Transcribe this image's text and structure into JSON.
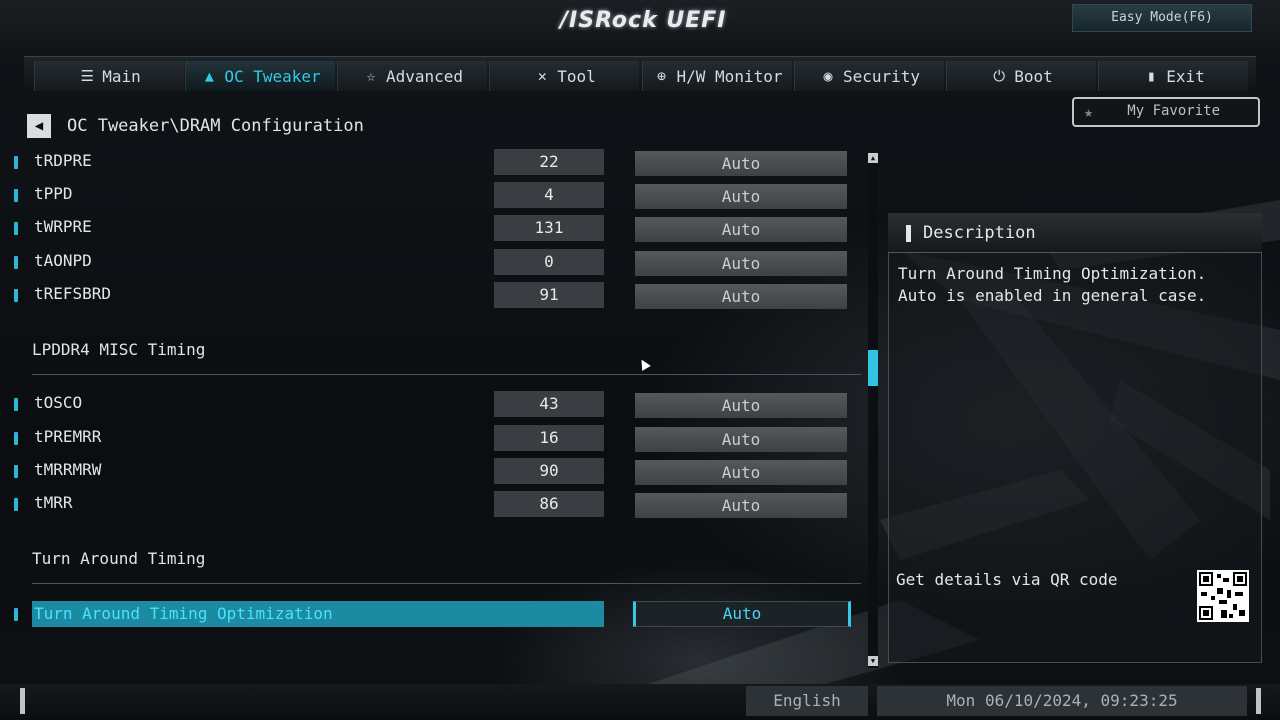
{
  "header": {
    "logo_text": "/ISRock UEFI",
    "easy_mode_label": "Easy Mode(F6)"
  },
  "tabs": [
    {
      "label": "Main",
      "icon": "list-icon"
    },
    {
      "label": "OC Tweaker",
      "icon": "rocket-icon",
      "active": true
    },
    {
      "label": "Advanced",
      "icon": "star-icon"
    },
    {
      "label": "Tool",
      "icon": "tools-icon"
    },
    {
      "label": "H/W Monitor",
      "icon": "crosshair-icon"
    },
    {
      "label": "Security",
      "icon": "shield-icon"
    },
    {
      "label": "Boot",
      "icon": "power-icon"
    },
    {
      "label": "Exit",
      "icon": "exit-door-icon"
    }
  ],
  "breadcrumb": "OC Tweaker\\DRAM Configuration",
  "favorite_label": "My Favorite",
  "rows_top": [
    {
      "name": "tRDPRE",
      "value": "22",
      "mode": "Auto"
    },
    {
      "name": "tPPD",
      "value": "4",
      "mode": "Auto"
    },
    {
      "name": "tWRPRE",
      "value": "131",
      "mode": "Auto"
    },
    {
      "name": "tAONPD",
      "value": "0",
      "mode": "Auto"
    },
    {
      "name": "tREFSBRD",
      "value": "91",
      "mode": "Auto"
    }
  ],
  "section_misc": "LPDDR4 MISC Timing",
  "rows_misc": [
    {
      "name": "tOSCO",
      "value": "43",
      "mode": "Auto"
    },
    {
      "name": "tPREMRR",
      "value": "16",
      "mode": "Auto"
    },
    {
      "name": "tMRRMRW",
      "value": "90",
      "mode": "Auto"
    },
    {
      "name": "tMRR",
      "value": "86",
      "mode": "Auto"
    }
  ],
  "section_turn": "Turn Around Timing",
  "selected_row": {
    "name": "Turn Around Timing Optimization",
    "mode": "Auto"
  },
  "description": {
    "title": "Description",
    "text": "Turn Around Timing Optimization.\nAuto is enabled in general case.",
    "qr_label": "Get details via QR code"
  },
  "footer": {
    "language": "English",
    "datetime": "Mon 06/10/2024, 09:23:25"
  }
}
